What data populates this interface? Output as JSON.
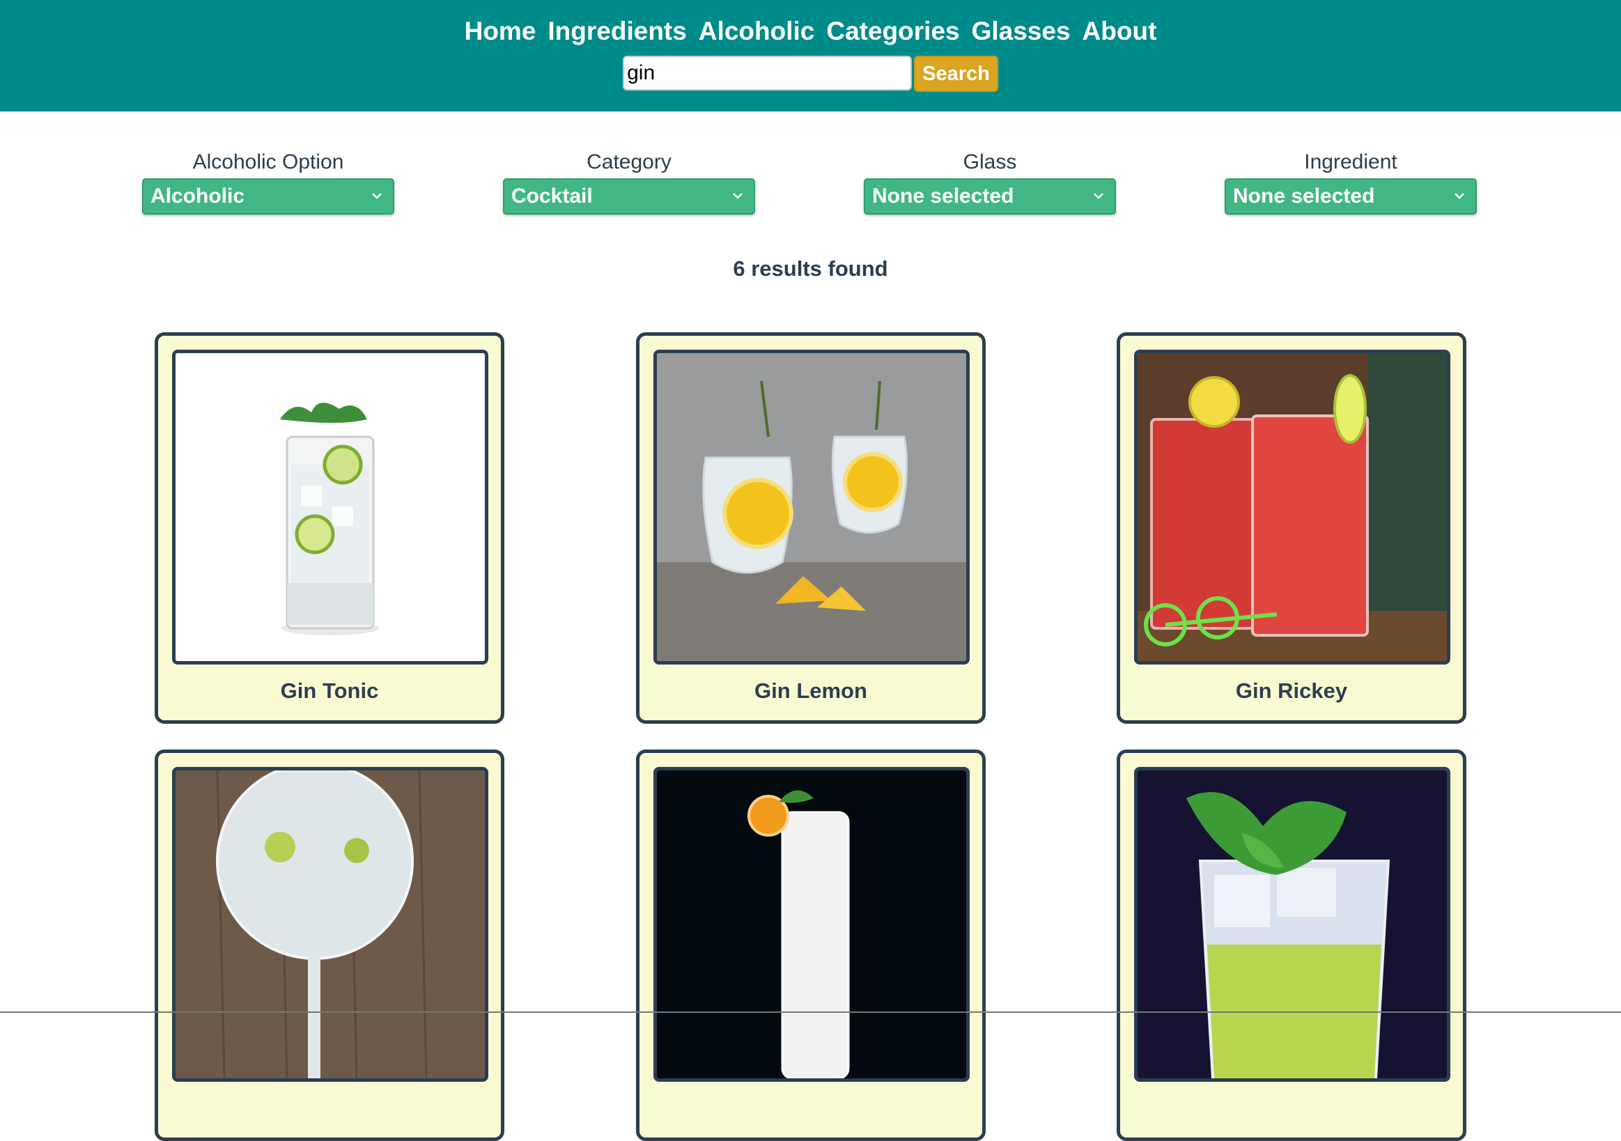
{
  "nav": {
    "items": [
      {
        "label": "Home",
        "name": "nav-home"
      },
      {
        "label": "Ingredients",
        "name": "nav-ingredients"
      },
      {
        "label": "Alcoholic",
        "name": "nav-alcoholic"
      },
      {
        "label": "Categories",
        "name": "nav-categories"
      },
      {
        "label": "Glasses",
        "name": "nav-glasses"
      },
      {
        "label": "About",
        "name": "nav-about"
      }
    ]
  },
  "search": {
    "value": "gin",
    "button_label": "Search"
  },
  "filters": [
    {
      "label": "Alcoholic Option",
      "selected": "Alcoholic"
    },
    {
      "label": "Category",
      "selected": "Cocktail"
    },
    {
      "label": "Glass",
      "selected": "None selected"
    },
    {
      "label": "Ingredient",
      "selected": "None selected"
    }
  ],
  "results": {
    "text": "6 results found"
  },
  "drinks": [
    {
      "name": "Gin Tonic",
      "image_icon": "tall-glass-lime-icon"
    },
    {
      "name": "Gin Lemon",
      "image_icon": "two-glasses-lemon-icon"
    },
    {
      "name": "Gin Rickey",
      "image_icon": "red-drinks-icon"
    },
    {
      "name": "",
      "image_icon": "gin-goblet-icon"
    },
    {
      "name": "",
      "image_icon": "white-highball-icon"
    },
    {
      "name": "",
      "image_icon": "green-basil-drink-icon"
    }
  ],
  "colors": {
    "header": "#008b8b",
    "search_button": "#daa520",
    "select": "#41b883",
    "card_bg": "#fafad2",
    "text": "#2c3e50"
  }
}
